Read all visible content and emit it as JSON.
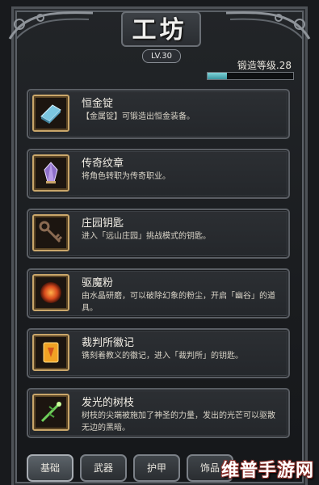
{
  "header": {
    "title": "工坊",
    "level_label": "LV.30",
    "forge_label": "锻造等级.28",
    "forge_progress": 0.23
  },
  "items": [
    {
      "name": "恒金锭",
      "desc": "【金属锭】可锻造出恒金装备。",
      "icon": "ingot-icon"
    },
    {
      "name": "传奇纹章",
      "desc": "将角色转职为传奇职业。",
      "icon": "crystal-emblem-icon"
    },
    {
      "name": "庄园钥匙",
      "desc": "进入「远山庄园」挑战模式的钥匙。",
      "icon": "key-icon"
    },
    {
      "name": "驱魔粉",
      "desc": "由水晶研磨，可以破除幻象的粉尘，开启「幽谷」的道具。",
      "icon": "powder-icon"
    },
    {
      "name": "裁判所徽记",
      "desc": "镌刻着教义的徽记，进入「裁判所」的钥匙。",
      "icon": "badge-icon"
    },
    {
      "name": "发光的树枝",
      "desc": "树枝的尖端被施加了神圣的力量，发出的光芒可以驱散无边的黑暗。",
      "icon": "glowing-branch-icon"
    }
  ],
  "tabs": [
    {
      "label": "基础",
      "active": true
    },
    {
      "label": "武器",
      "active": false
    },
    {
      "label": "护甲",
      "active": false
    },
    {
      "label": "饰品",
      "active": false
    }
  ],
  "watermark": "维普手游网",
  "colors": {
    "icon_border": "#c9a66a",
    "progress_fill": "#5fc0c8",
    "panel_bg": "#2a2d31"
  }
}
